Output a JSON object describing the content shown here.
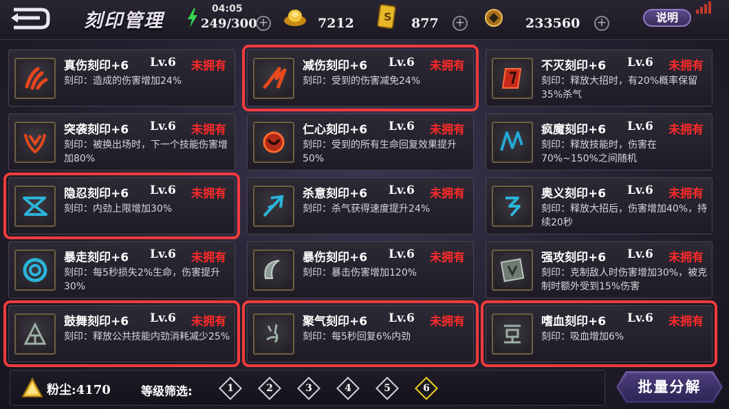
{
  "header": {
    "title": "刻印管理",
    "clock": "04:05",
    "stamina": "249/300",
    "gold_ingot": "7212",
    "card_currency": "877",
    "coins": "233560",
    "help_label": "说明"
  },
  "cards": [
    {
      "name": "真伤刻印+6",
      "level": "Lv.6",
      "status": "未拥有",
      "desc": "刻印：造成的伤害增加24%",
      "icon": "claw-rune-icon"
    },
    {
      "name": "减伤刻印+6",
      "level": "Lv.6",
      "status": "未拥有",
      "desc": "刻印：受到的伤害减免24%",
      "icon": "slash-rune-icon"
    },
    {
      "name": "不灭刻印+6",
      "level": "Lv.6",
      "status": "未拥有",
      "desc": "刻印：释放大招时，有20%概率保留35%杀气",
      "icon": "shield-rune-icon"
    },
    {
      "name": "突袭刻印+6",
      "level": "Lv.6",
      "status": "未拥有",
      "desc": "刻印：被换出场时，下一个技能伤害增加80%",
      "icon": "horns-rune-icon"
    },
    {
      "name": "仁心刻印+6",
      "level": "Lv.6",
      "status": "未拥有",
      "desc": "刻印：受到的所有生命回复效果提升50%",
      "icon": "heart-rune-icon"
    },
    {
      "name": "疯魔刻印+6",
      "level": "Lv.6",
      "status": "未拥有",
      "desc": "刻印：释放技能时，伤害在70%~150%之间随机",
      "icon": "zigzag-rune-icon"
    },
    {
      "name": "隐忍刻印+6",
      "level": "Lv.6",
      "status": "未拥有",
      "desc": "刻印：内劲上限增加30%",
      "icon": "ribbon-rune-icon"
    },
    {
      "name": "杀意刻印+6",
      "level": "Lv.6",
      "status": "未拥有",
      "desc": "刻印：杀气获得速度提升24%",
      "icon": "arrow-rune-icon"
    },
    {
      "name": "奥义刻印+6",
      "level": "Lv.6",
      "status": "未拥有",
      "desc": "刻印：释放大招后，伤害增加40%，持续20秒",
      "icon": "glyph-rune-icon"
    },
    {
      "name": "暴走刻印+6",
      "level": "Lv.6",
      "status": "未拥有",
      "desc": "刻印：每5秒损失2%生命，伤害提升30%",
      "icon": "ring-rune-icon"
    },
    {
      "name": "暴伤刻印+6",
      "level": "Lv.6",
      "status": "未拥有",
      "desc": "刻印：暴击伤害增加120%",
      "icon": "crescent-rune-icon"
    },
    {
      "name": "强攻刻印+6",
      "level": "Lv.6",
      "status": "未拥有",
      "desc": "刻印：克制敌人时伤害增加30%，被克制时额外受到15%伤害",
      "icon": "tablet-rune-icon"
    },
    {
      "name": "鼓舞刻印+6",
      "level": "Lv.6",
      "status": "未拥有",
      "desc": "刻印：释放公共技能内劲消耗减少25%",
      "icon": "tent-rune-icon"
    },
    {
      "name": "聚气刻印+6",
      "level": "Lv.6",
      "status": "未拥有",
      "desc": "刻印：每5秒回复6%内劲",
      "icon": "flame-rune-icon"
    },
    {
      "name": "嗜血刻印+6",
      "level": "Lv.6",
      "status": "未拥有",
      "desc": "刻印：吸血增加6%",
      "icon": "box-rune-icon"
    }
  ],
  "footer": {
    "dust": "粉尘:4170",
    "filter_label": "等级筛选:",
    "levels": [
      "1",
      "2",
      "3",
      "4",
      "5",
      "6"
    ],
    "active_level": "6",
    "batch_label": "批量分解"
  },
  "colors": {
    "selected_outline": "#f23b3b",
    "status_red": "#ff2a2a",
    "active_level": "#f5d323"
  }
}
